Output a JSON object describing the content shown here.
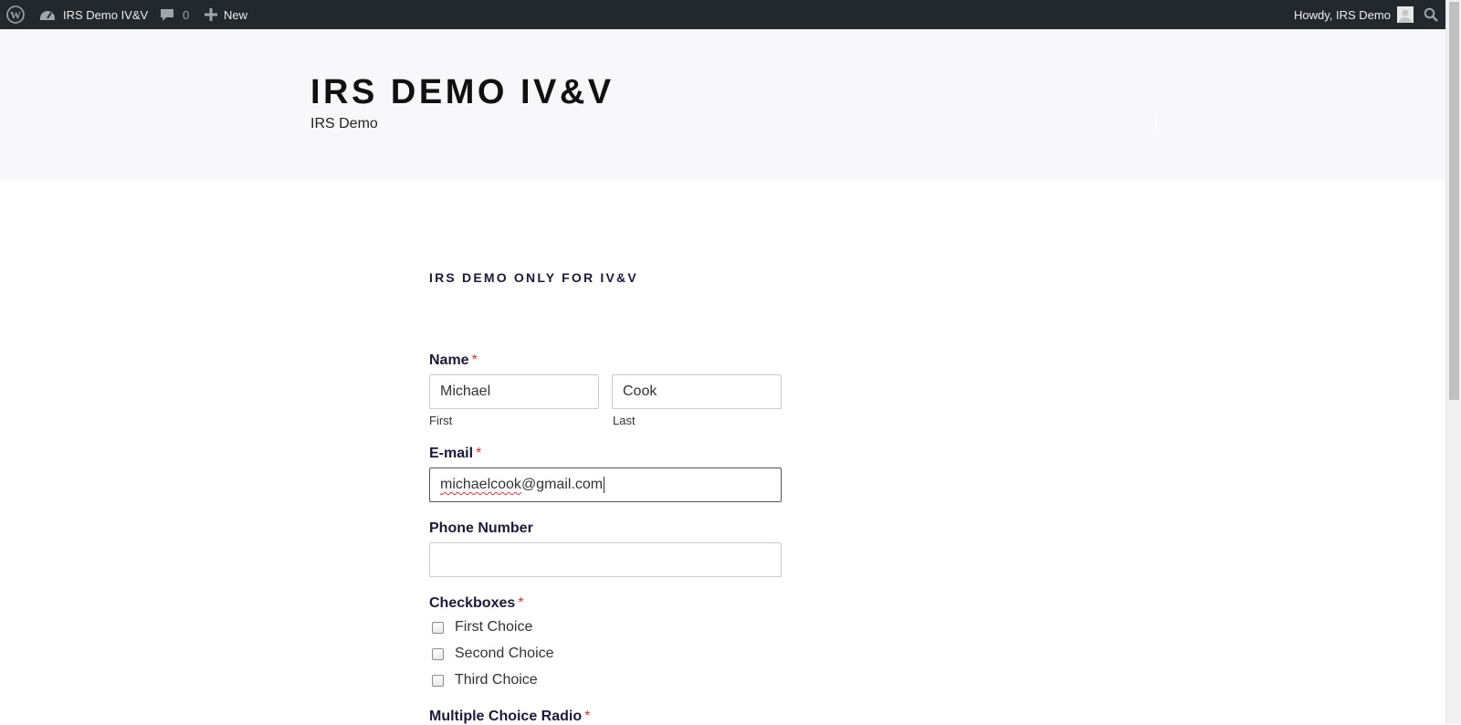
{
  "adminbar": {
    "site_name": "IRS Demo IV&V",
    "comments_count": "0",
    "new_label": "New",
    "greeting": "Howdy, IRS Demo"
  },
  "header": {
    "title": "IRS DEMO IV&V",
    "description": "IRS Demo"
  },
  "page": {
    "heading": "IRS DEMO ONLY FOR IV&V"
  },
  "form": {
    "name": {
      "label": "Name",
      "required_mark": "*",
      "first_value": "Michael",
      "first_sublabel": "First",
      "last_value": "Cook",
      "last_sublabel": "Last"
    },
    "email": {
      "label": "E-mail",
      "required_mark": "*",
      "value_user": "michaelcook",
      "value_domain": "@gmail.com"
    },
    "phone": {
      "label": "Phone Number",
      "value": ""
    },
    "checkboxes": {
      "label": "Checkboxes",
      "required_mark": "*",
      "options": [
        "First Choice",
        "Second Choice",
        "Third Choice"
      ]
    },
    "radio": {
      "label": "Multiple Choice Radio",
      "required_mark": "*"
    }
  }
}
